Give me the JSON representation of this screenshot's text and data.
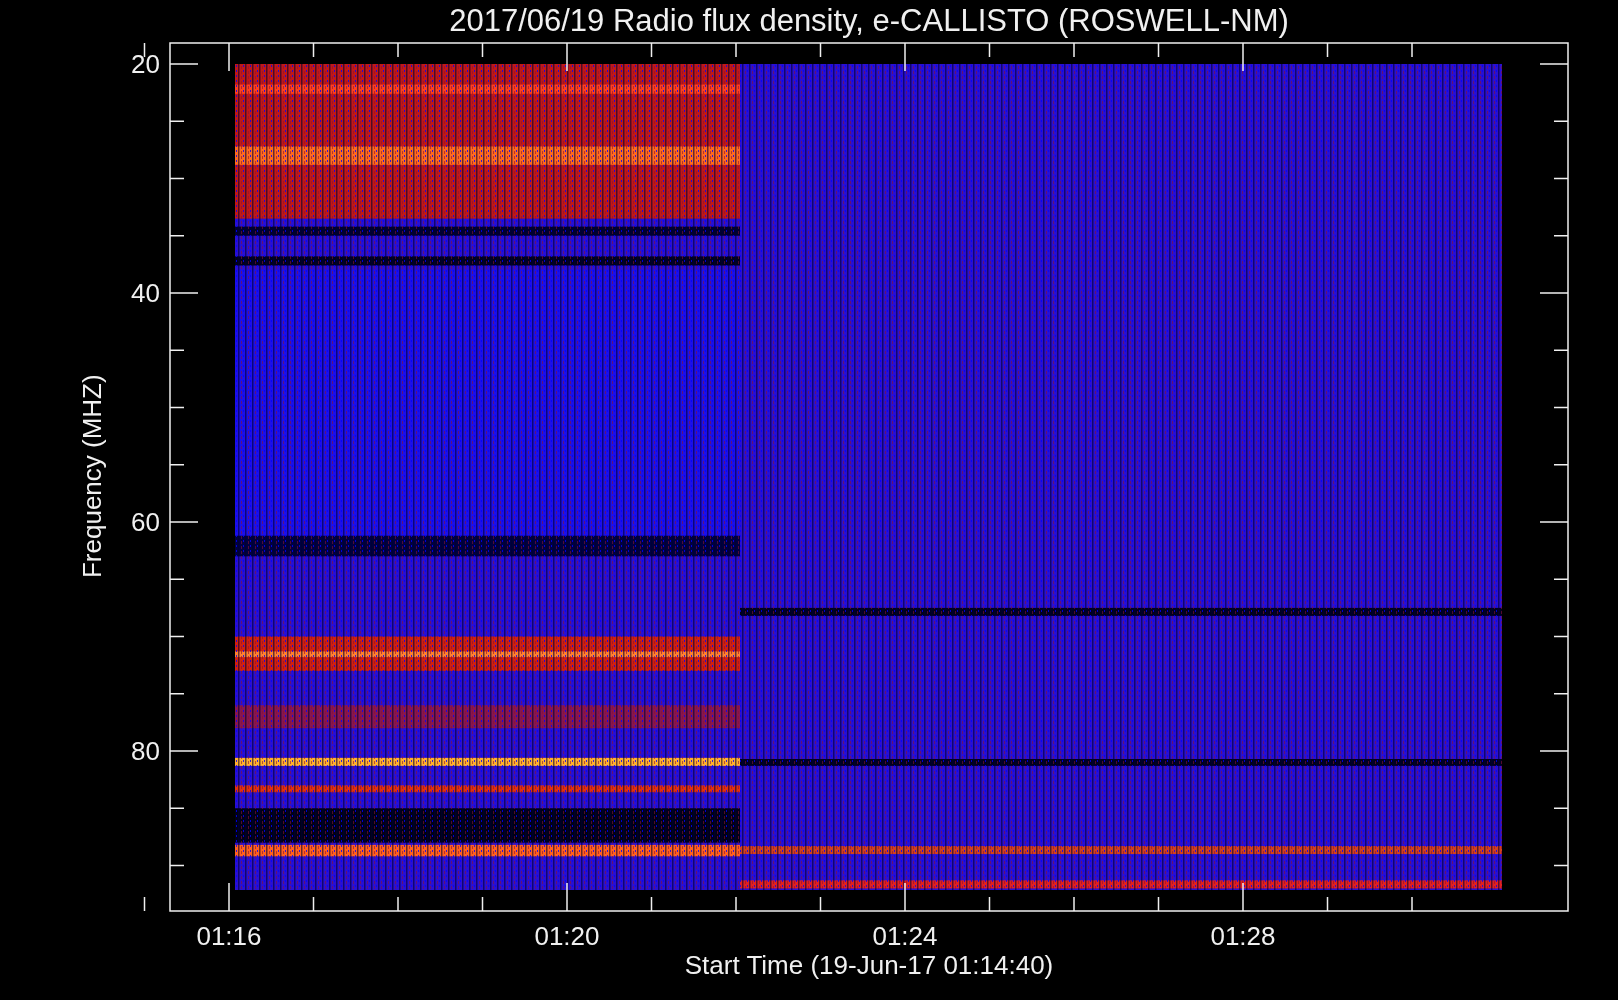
{
  "title": "2017/06/19  Radio flux density, e-CALLISTO (ROSWELL-NM)",
  "y_axis": {
    "label": "Frequency (MHZ)",
    "ticks": [
      "20",
      "40",
      "60",
      "80"
    ]
  },
  "x_axis": {
    "label": "Start Time (19-Jun-17 01:14:40)",
    "ticks": [
      "01:16",
      "01:20",
      "01:24",
      "01:28"
    ]
  }
}
